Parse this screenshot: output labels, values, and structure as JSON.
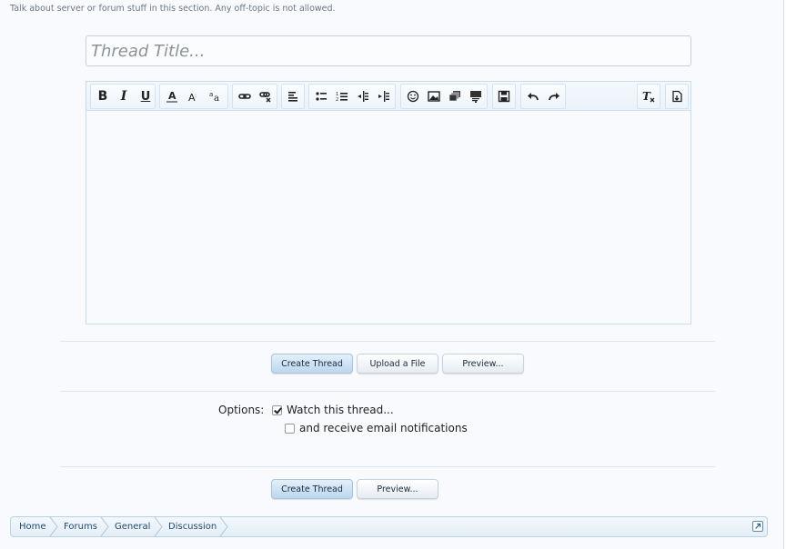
{
  "forum": {
    "description": "Talk about server or forum stuff in this section. Any off-topic is not allowed."
  },
  "thread_form": {
    "title_placeholder": "Thread Title..."
  },
  "editor": {
    "toolbar": [
      {
        "group": "text-style",
        "items": [
          "bold-icon",
          "italic-icon",
          "underline-icon"
        ]
      },
      {
        "group": "font",
        "items": [
          "text-color-icon",
          "font-size-icon",
          "font-family-icon"
        ]
      },
      {
        "group": "links",
        "items": [
          "link-icon",
          "unlink-icon"
        ]
      },
      {
        "group": "align",
        "items": [
          "align-left-icon"
        ]
      },
      {
        "group": "lists",
        "items": [
          "bullet-list-icon",
          "numbered-list-icon",
          "outdent-icon",
          "indent-icon"
        ]
      },
      {
        "group": "insert",
        "items": [
          "smiley-icon",
          "image-icon",
          "media-icon",
          "code-icon"
        ]
      },
      {
        "group": "draft",
        "items": [
          "save-draft-icon"
        ]
      },
      {
        "group": "history",
        "items": [
          "undo-icon",
          "redo-icon"
        ]
      },
      {
        "group": "format",
        "items": [
          "remove-formatting-icon"
        ]
      },
      {
        "group": "mode",
        "items": [
          "toggle-bbcode-icon"
        ]
      }
    ],
    "bold_label": "B",
    "italic_label": "I",
    "underline_label": "U"
  },
  "buttons": {
    "create_thread": "Create Thread",
    "upload_file": "Upload a File",
    "preview": "Preview..."
  },
  "options": {
    "label": "Options:",
    "watch_thread": "Watch this thread...",
    "watch_checked": true,
    "email_notifications": "and receive email notifications",
    "email_checked": false
  },
  "breadcrumb": [
    "Home",
    "Forums",
    "General",
    "Discussion"
  ],
  "colors": {
    "accent": "#1f4a6e",
    "border": "#b9d2e6",
    "primary_button": "#bcd7ee"
  }
}
